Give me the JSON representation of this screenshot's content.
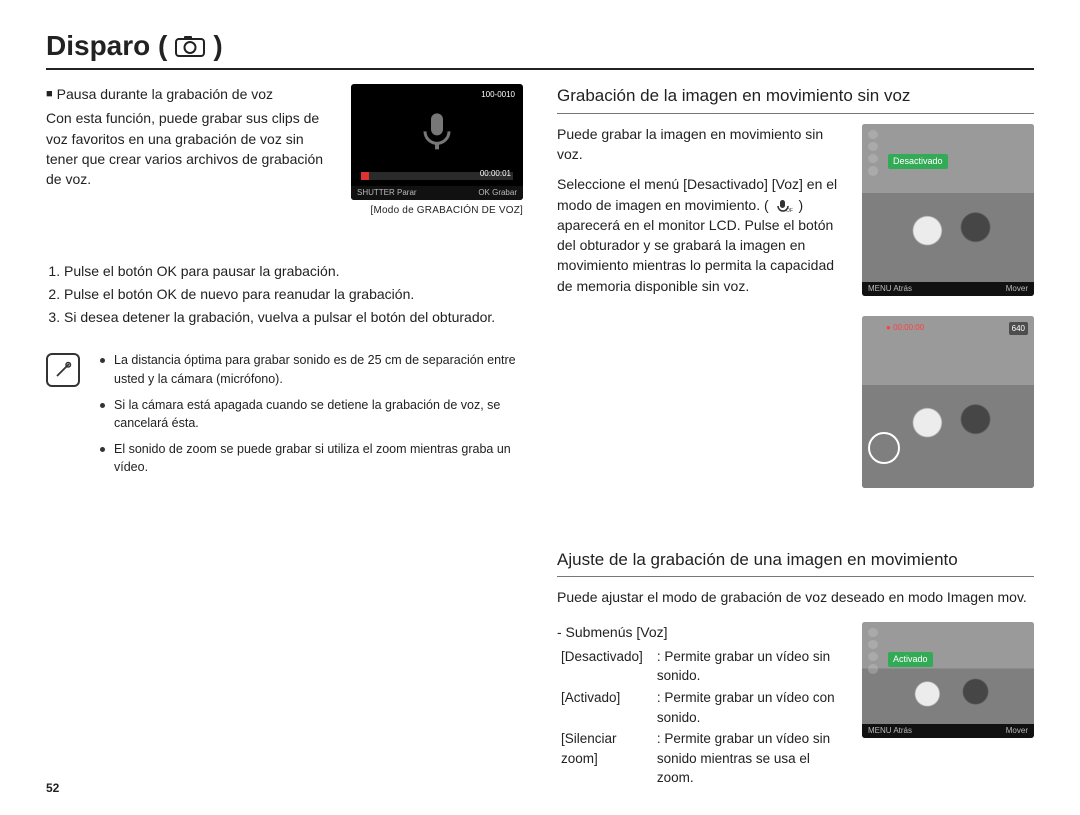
{
  "title": "Disparo (",
  "title_close": ")",
  "page_number": "52",
  "left": {
    "heading": "Pausa durante la grabación de voz",
    "intro": "Con esta función, puede grabar sus clips de voz favoritos en una grabación de voz sin tener que crear varios archivos de grabación de voz.",
    "voice_thumb": {
      "index": "100-0010",
      "time": "00:00:01",
      "bar_left": "SHUTTER Parar",
      "bar_right": "OK Grabar"
    },
    "voice_caption": "[Modo de GRABACIÓN DE VOZ]",
    "steps": [
      "Pulse el botón OK para pausar la grabación.",
      "Pulse el botón OK de nuevo para reanudar la grabación.",
      "Si desea detener la grabación, vuelva a pulsar el botón del obturador."
    ],
    "tips": [
      "La distancia óptima para grabar sonido es de 25 cm de separación entre usted y la cámara (micrófono).",
      "Si la cámara está apagada cuando se detiene la grabación de voz, se cancelará ésta.",
      "El sonido de zoom se puede grabar si utiliza el zoom mientras graba un vídeo."
    ]
  },
  "right": {
    "sec1": {
      "heading": "Grabación de la imagen en movimiento sin voz",
      "p1": "Puede grabar la imagen en movimiento sin voz.",
      "p2a": "Seleccione el menú [Desactivado] [Voz] en el modo de imagen en movimiento.",
      "p2b": "aparecerá en el monitor LCD. Pulse el botón del obturador y se grabará la imagen en movimiento mientras lo permita la capacidad de memoria disponible sin voz.",
      "thumb1": {
        "label": "Desactivado",
        "bar_left": "MENU Atrás",
        "bar_right": "Mover"
      },
      "thumb2": {
        "badge": "640",
        "time": "00:00:00"
      }
    },
    "sec2": {
      "heading": "Ajuste de la grabación de una imagen en movimiento",
      "intro": "Puede ajustar el modo de grabación de voz deseado en modo Imagen mov.",
      "submenu_label": "- Submenús [Voz]",
      "rows": [
        {
          "k": "[Desactivado]",
          "v": ": Permite grabar un vídeo sin sonido."
        },
        {
          "k": "[Activado]",
          "v": ": Permite grabar un vídeo con sonido."
        },
        {
          "k": "[Silenciar zoom]",
          "v": ": Permite grabar un vídeo sin sonido mientras se usa el zoom."
        }
      ],
      "thumb": {
        "label": "Activado",
        "bar_left": "MENU Atrás",
        "bar_right": "Mover"
      }
    }
  }
}
